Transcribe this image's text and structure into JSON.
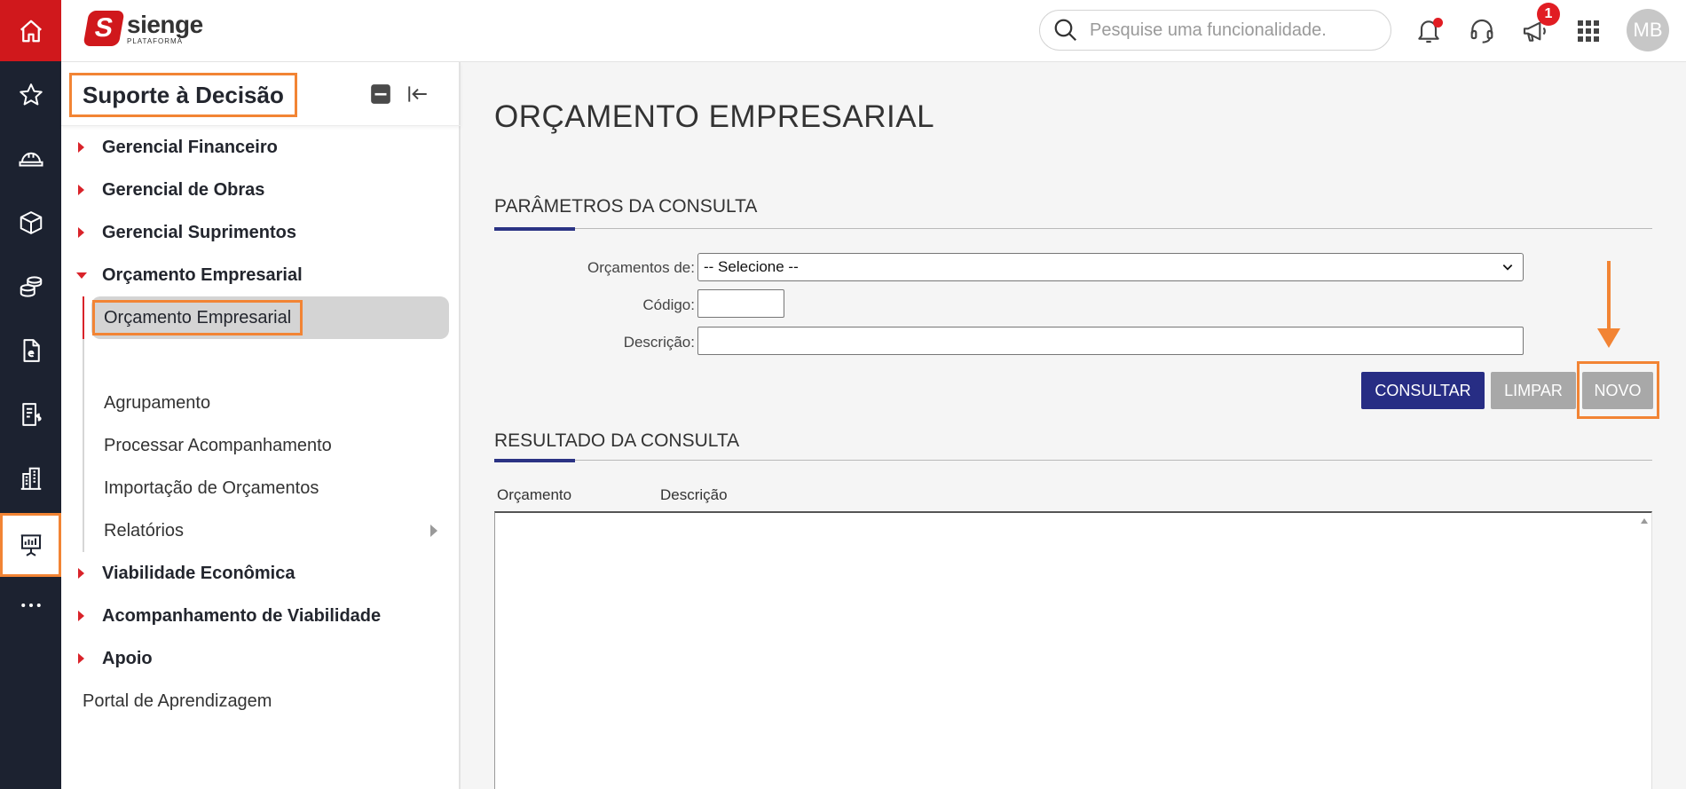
{
  "rail": {
    "items": [
      {
        "icon": "home-icon"
      },
      {
        "icon": "star-icon"
      },
      {
        "icon": "helmet-icon"
      },
      {
        "icon": "box-icon"
      },
      {
        "icon": "coins-icon"
      },
      {
        "icon": "document-icon"
      },
      {
        "icon": "invoice-icon"
      },
      {
        "icon": "building-icon"
      },
      {
        "icon": "presentation-board-icon",
        "active": true
      },
      {
        "icon": "more-dots-icon"
      }
    ]
  },
  "header": {
    "logo_name": "sienge",
    "logo_sub": "PLATAFORMA",
    "search_placeholder": "Pesquise uma funcionalidade.",
    "announcement_badge": "1",
    "avatar_initials": "MB"
  },
  "sidebar": {
    "title": "Suporte à Decisão",
    "items": [
      {
        "label": "Gerencial Financeiro"
      },
      {
        "label": "Gerencial de Obras"
      },
      {
        "label": "Gerencial Suprimentos"
      },
      {
        "label": "Orçamento Empresarial",
        "expanded": true
      }
    ],
    "subitems": [
      {
        "label": "Orçamento Empresarial",
        "selected": true
      },
      {
        "label": "Agrupamento"
      },
      {
        "label": "Processar Acompanhamento"
      },
      {
        "label": "Importação de Orçamentos"
      },
      {
        "label": "Relatórios"
      }
    ],
    "items_after": [
      {
        "label": "Viabilidade Econômica"
      },
      {
        "label": "Acompanhamento de Viabilidade"
      },
      {
        "label": "Apoio"
      }
    ],
    "portal": "Portal de Aprendizagem"
  },
  "main": {
    "page_title": "ORÇAMENTO EMPRESARIAL",
    "params_title": "PARÂMETROS DA CONSULTA",
    "fields": {
      "orcamentos_label": "Orçamentos de:",
      "orcamentos_value": "-- Selecione --",
      "codigo_label": "Código:",
      "codigo_value": "",
      "descricao_label": "Descrição:",
      "descricao_value": ""
    },
    "buttons": {
      "consultar": "CONSULTAR",
      "limpar": "LIMPAR",
      "novo": "NOVO"
    },
    "result_title": "RESULTADO DA CONSULTA",
    "columns": [
      "Orçamento",
      "Descrição"
    ]
  },
  "colors": {
    "brand_red": "#d0181c",
    "rail_bg": "#1c2230",
    "primary_button": "#272d84",
    "highlight_orange": "#f28434"
  }
}
